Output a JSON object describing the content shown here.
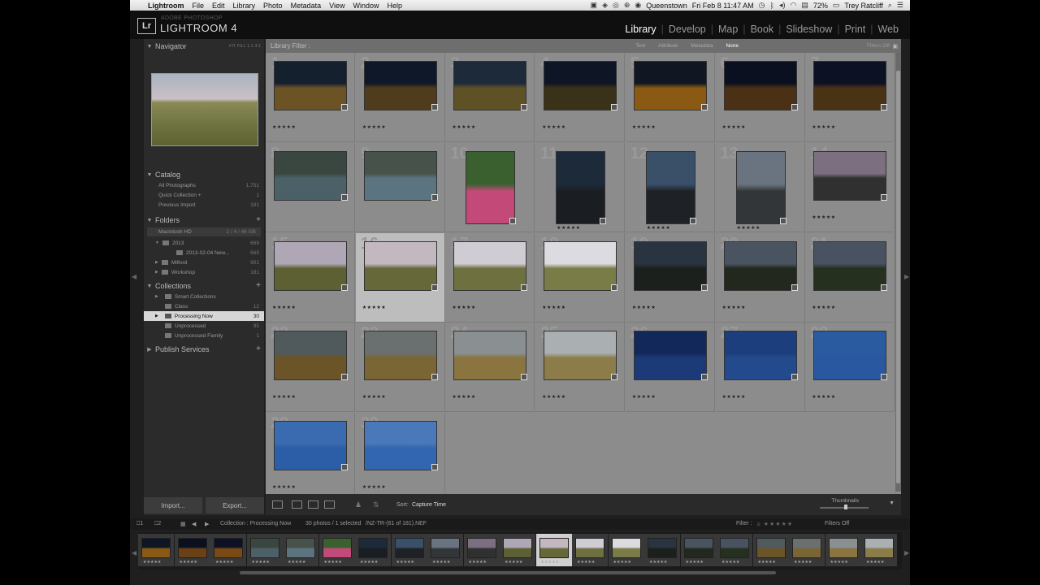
{
  "menubar": {
    "apple": "",
    "app": "Lightroom",
    "items": [
      "File",
      "Edit",
      "Library",
      "Photo",
      "Metadata",
      "View",
      "Window",
      "Help"
    ],
    "location": "Queenstown",
    "datetime": "Fri Feb 8  11:47 AM",
    "battery": "72%",
    "user": "Trey Ratcliff"
  },
  "header": {
    "logo": "Lr",
    "brand_small": "ADOBE PHOTOSHOP",
    "brand": "LIGHTROOM 4",
    "modules": [
      "Library",
      "Develop",
      "Map",
      "Book",
      "Slideshow",
      "Print",
      "Web"
    ],
    "active_module": "Library"
  },
  "left": {
    "navigator": {
      "title": "Navigator",
      "zoom": "FIT  FILL  1:1  3:1"
    },
    "catalog": {
      "title": "Catalog",
      "items": [
        {
          "label": "All Photographs",
          "count": "1,751"
        },
        {
          "label": "Quick Collection +",
          "count": "1"
        },
        {
          "label": "Previous Import",
          "count": "181"
        }
      ]
    },
    "folders": {
      "title": "Folders",
      "volume": "Macintosh HD",
      "volume_info": "2 / 4 / 46 GB",
      "items": [
        {
          "label": "2013",
          "count": "669"
        },
        {
          "label": "2013-02-04 New...",
          "count": "669"
        },
        {
          "label": "Milford",
          "count": "901"
        },
        {
          "label": "Workshop",
          "count": "181"
        }
      ]
    },
    "collections": {
      "title": "Collections",
      "items": [
        {
          "label": "Smart Collections",
          "count": ""
        },
        {
          "label": "Class",
          "count": "12"
        },
        {
          "label": "Processing Now",
          "count": "30"
        },
        {
          "label": "Unprocessed",
          "count": "95"
        },
        {
          "label": "Unprocessed Family",
          "count": "1"
        }
      ]
    },
    "publish": {
      "title": "Publish Services"
    }
  },
  "filterbar": {
    "title": "Library Filter :",
    "options": [
      "Text",
      "Attribute",
      "Metadata",
      "None"
    ],
    "active": "None",
    "filters_off": "Filters Off"
  },
  "grid": {
    "cells": [
      {
        "n": "1",
        "stars": "★★★★★",
        "c1": "#15202e",
        "c2": "#6b5326"
      },
      {
        "n": "2",
        "stars": "★★★★★",
        "c1": "#0f1828",
        "c2": "#4e3c1c"
      },
      {
        "n": "3",
        "stars": "★★★★★",
        "c1": "#1c2a3a",
        "c2": "#5e5126"
      },
      {
        "n": "4",
        "stars": "★★★★★",
        "c1": "#0e1524",
        "c2": "#3a3218"
      },
      {
        "n": "5",
        "stars": "★★★★★",
        "c1": "#101722",
        "c2": "#8a5a14"
      },
      {
        "n": "6",
        "stars": "★★★★★",
        "c1": "#0b1020",
        "c2": "#4a3015"
      },
      {
        "n": "7",
        "stars": "★★★★★",
        "c1": "#0c1224",
        "c2": "#4a3215"
      },
      {
        "n": "8",
        "stars": "",
        "c1": "#3a4640",
        "c2": "#4c6068"
      },
      {
        "n": "9",
        "stars": "",
        "c1": "#46524a",
        "c2": "#5c7480"
      },
      {
        "n": "10",
        "stars": "",
        "c1": "#3a6030",
        "c2": "#c34a78"
      },
      {
        "n": "11",
        "stars": "★★★★★",
        "c1": "#1c2a3a",
        "c2": "#1a1e22"
      },
      {
        "n": "12",
        "stars": "★★★★★",
        "c1": "#3a5068",
        "c2": "#1e2226"
      },
      {
        "n": "13",
        "stars": "★★★★★",
        "c1": "#6a7480",
        "c2": "#323638"
      },
      {
        "n": "14",
        "stars": "★★★★★",
        "c1": "#7c7080",
        "c2": "#303030"
      },
      {
        "n": "15",
        "stars": "★★★★★",
        "c1": "#b0a7b6",
        "c2": "#5c6032"
      },
      {
        "n": "16",
        "stars": "★★★★★",
        "c1": "#c4b8c0",
        "c2": "#66683a"
      },
      {
        "n": "17",
        "stars": "★★★★★",
        "c1": "#d0ccd4",
        "c2": "#6e7040"
      },
      {
        "n": "18",
        "stars": "★★★★★",
        "c1": "#dcdce0",
        "c2": "#7a7c48"
      },
      {
        "n": "19",
        "stars": "★★★★★",
        "c1": "#2a3440",
        "c2": "#1c201c"
      },
      {
        "n": "20",
        "stars": "★★★★★",
        "c1": "#4a5460",
        "c2": "#22281e"
      },
      {
        "n": "21",
        "stars": "★★★★★",
        "c1": "#485260",
        "c2": "#26301e"
      },
      {
        "n": "22",
        "stars": "★★★★★",
        "c1": "#505a5c",
        "c2": "#6a5428"
      },
      {
        "n": "23",
        "stars": "★★★★★",
        "c1": "#6a7070",
        "c2": "#7a6634"
      },
      {
        "n": "24",
        "stars": "★★★★★",
        "c1": "#8a9092",
        "c2": "#8a7440"
      },
      {
        "n": "25",
        "stars": "★★★★★",
        "c1": "#aab0b2",
        "c2": "#8c7c4a"
      },
      {
        "n": "26",
        "stars": "★★★★★",
        "c1": "#12285a",
        "c2": "#1c3a78"
      },
      {
        "n": "27",
        "stars": "★★★★★",
        "c1": "#1c3e7c",
        "c2": "#224a8c"
      },
      {
        "n": "28",
        "stars": "★★★★★",
        "c1": "#2a5aa0",
        "c2": "#2a58a0"
      },
      {
        "n": "29",
        "stars": "★★★★★",
        "c1": "#3a6ab0",
        "c2": "#2c5ea8"
      },
      {
        "n": "30",
        "stars": "★★★★★",
        "c1": "#4a78b8",
        "c2": "#3266b0"
      }
    ],
    "selected": "16"
  },
  "toolbar": {
    "sort_label": "Sort:",
    "sort_value": "Capture Time",
    "thumbnails": "Thumbnails"
  },
  "buttons": {
    "import": "Import...",
    "export": "Export..."
  },
  "filminfo": {
    "collection": "Collection : Processing Now",
    "count": "30 photos / 1 selected",
    "file": "/NZ-TR-(61 of 181).NEF",
    "filter_label": "Filter :",
    "filters_off": "Filters Off"
  },
  "filmstrip": {
    "items": [
      {
        "c1": "#0e1524",
        "c2": "#8a5a14"
      },
      {
        "c1": "#0b1020",
        "c2": "#6a4015"
      },
      {
        "c1": "#0c1224",
        "c2": "#7a4a15"
      },
      {
        "c1": "#3a4640",
        "c2": "#4c6068"
      },
      {
        "c1": "#46524a",
        "c2": "#5c7480"
      },
      {
        "c1": "#3a6030",
        "c2": "#c34a78"
      },
      {
        "c1": "#1c2a3a",
        "c2": "#1a1e22"
      },
      {
        "c1": "#3a5068",
        "c2": "#1e2226"
      },
      {
        "c1": "#6a7480",
        "c2": "#323638"
      },
      {
        "c1": "#7c7080",
        "c2": "#303030"
      },
      {
        "c1": "#b0a7b6",
        "c2": "#5c6032"
      },
      {
        "c1": "#c4b8c0",
        "c2": "#66683a"
      },
      {
        "c1": "#d0ccd4",
        "c2": "#6e7040"
      },
      {
        "c1": "#dcdce0",
        "c2": "#7a7c48"
      },
      {
        "c1": "#2a3440",
        "c2": "#1c201c"
      },
      {
        "c1": "#4a5460",
        "c2": "#22281e"
      },
      {
        "c1": "#485260",
        "c2": "#26301e"
      },
      {
        "c1": "#505a5c",
        "c2": "#6a5428"
      },
      {
        "c1": "#6a7070",
        "c2": "#7a6634"
      },
      {
        "c1": "#8a9092",
        "c2": "#8a7440"
      },
      {
        "c1": "#aab0b2",
        "c2": "#8c7c4a"
      }
    ],
    "selected_index": 11
  }
}
